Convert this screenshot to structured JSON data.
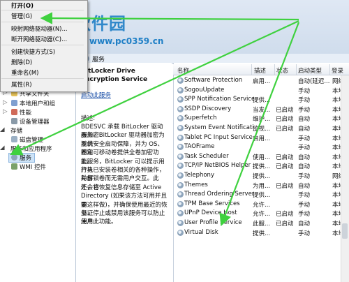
{
  "watermark": {
    "title": "河东软件园",
    "url": "www.pc0359.cn"
  },
  "context_menu": {
    "items": [
      {
        "label": "打开(O)",
        "bold": true
      },
      {
        "label": "管理(G)"
      },
      {
        "label": "映射网络驱动器(N)..."
      },
      {
        "label": "断开网络驱动器(C)..."
      },
      {
        "label": "创建快捷方式(S)"
      },
      {
        "label": "删除(D)"
      },
      {
        "label": "重命名(M)"
      },
      {
        "label": "属性(R)"
      }
    ]
  },
  "tree": {
    "items": [
      {
        "label": "共享文件夹"
      },
      {
        "label": "本地用户和组"
      },
      {
        "label": "性能"
      },
      {
        "label": "设备管理器"
      },
      {
        "label": "存储"
      },
      {
        "label": "磁盘管理"
      },
      {
        "label": "服务和应用程序"
      },
      {
        "label": "服务"
      },
      {
        "label": "WMI 控件"
      }
    ]
  },
  "tab": {
    "label": "服务"
  },
  "description_pane": {
    "service_title": "BitLocker Drive Encryption Service",
    "action_link": "启动此服务",
    "desc_heading": "描述:",
    "desc_lines": [
      "BDESVC 承载 BitLocker 驱动器加密",
      "服务。BitLocker 驱动器加密为系统",
      "提供安全启动保障，并为 OS、固定",
      "卷和可移动卷提供全卷加密功能。",
      "此服务，BitLocker 可以提示用户执",
      "行与已安装卷相关的各种操作，并自",
      "动解锁卷而无需用户交互。此外，它",
      "还会将恢复信息存储至 Active",
      "Directory (如果该方法可用并且需",
      "要这样做)，并确保使用最近的恢复证",
      "书。停止或禁用该服务可以防止用户",
      "使用此功能。"
    ]
  },
  "list": {
    "columns": [
      "名称",
      "描述",
      "状态",
      "启动类型",
      "登录"
    ],
    "rows": [
      {
        "name": "Software Protection",
        "desc": "启用...",
        "status": "",
        "start": "自动(延迟...",
        "login": "网络"
      },
      {
        "name": "SogouUpdate",
        "desc": "",
        "status": "",
        "start": "手动",
        "login": "本地"
      },
      {
        "name": "SPP Notification Service",
        "desc": "提供...",
        "status": "",
        "start": "手动",
        "login": "本地"
      },
      {
        "name": "SSDP Discovery",
        "desc": "当发...",
        "status": "已启动",
        "start": "手动",
        "login": "本地"
      },
      {
        "name": "Superfetch",
        "desc": "维护...",
        "status": "已启动",
        "start": "自动",
        "login": "本地"
      },
      {
        "name": "System Event Notification",
        "desc": "监视...",
        "status": "已启动",
        "start": "自动",
        "login": "本地"
      },
      {
        "name": "Tablet PC Input Service",
        "desc": "启用...",
        "status": "",
        "start": "手动",
        "login": "本地"
      },
      {
        "name": "TAOFrame",
        "desc": "",
        "status": "",
        "start": "手动",
        "login": "本地"
      },
      {
        "name": "Task Scheduler",
        "desc": "使用...",
        "status": "已启动",
        "start": "自动",
        "login": "本地"
      },
      {
        "name": "TCP/IP NetBIOS Helper",
        "desc": "提供...",
        "status": "已启动",
        "start": "自动",
        "login": "本地"
      },
      {
        "name": "Telephony",
        "desc": "提供...",
        "status": "",
        "start": "手动",
        "login": "网络"
      },
      {
        "name": "Themes",
        "desc": "为用...",
        "status": "已启动",
        "start": "自动",
        "login": "本地"
      },
      {
        "name": "Thread Ordering Server",
        "desc": "提供...",
        "status": "",
        "start": "手动",
        "login": "本地"
      },
      {
        "name": "TPM Base Services",
        "desc": "允许...",
        "status": "",
        "start": "手动",
        "login": "本地"
      },
      {
        "name": "UPnP Device Host",
        "desc": "允许...",
        "status": "已启动",
        "start": "手动",
        "login": "本地"
      },
      {
        "name": "User Profile Service",
        "desc": "此服...",
        "status": "已启动",
        "start": "自动",
        "login": "本地"
      },
      {
        "name": "Virtual Disk",
        "desc": "提供...",
        "status": "",
        "start": "手动",
        "login": "本地"
      }
    ]
  },
  "colors": {
    "annotation_arrow": "#3fd13f",
    "watermark": "#1f7fc6"
  }
}
